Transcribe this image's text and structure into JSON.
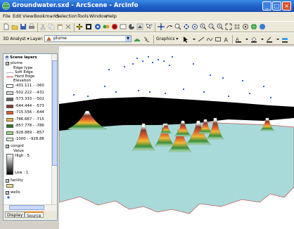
{
  "window": {
    "title": "Groundwater.sxd - ArcScene - ArcInfo",
    "buttons": {
      "minimize": "_",
      "maximize": "□",
      "close": "×"
    }
  },
  "menu": [
    "File",
    "Edit",
    "View",
    "Bookmarks",
    "Selection",
    "Tools",
    "Window",
    "Help"
  ],
  "toolbar2": {
    "analyst_label": "3D Analyst ▾",
    "layer_label": "Layer:",
    "layer_value": "plume",
    "graphics_label": "Graphics ▾"
  },
  "toc": {
    "root": "Scene layers",
    "plume": {
      "name": "plume",
      "edge_type": "Edge type",
      "soft_edge": "Soft Edge",
      "hard_edge": "Hard Edge",
      "elevation": "Elevation",
      "classes": [
        {
          "label": "-431.111 - -360",
          "color": "#ffffff"
        },
        {
          "label": "-502.222 - -431",
          "color": "#d9d9d9"
        },
        {
          "label": "-573.333 - -502",
          "color": "#6e6e6e"
        },
        {
          "label": "-644.444 - -573",
          "color": "#8c3a2e"
        },
        {
          "label": "-715.556 - -644",
          "color": "#dd5a2a"
        },
        {
          "label": "-786.667 - -715",
          "color": "#f2b733"
        },
        {
          "label": "-857.778 - -786",
          "color": "#1f7a1f"
        },
        {
          "label": "-928.889 - -857",
          "color": "#9ad98c"
        },
        {
          "label": "-1000 - -928.88",
          "color": "#e6f5e0"
        }
      ]
    },
    "congrd": {
      "name": "congrd",
      "value": "Value",
      "high": "High : 5",
      "low": "Low : 1"
    },
    "facility": {
      "name": "facility"
    },
    "wells": {
      "name": "wells"
    }
  },
  "tabs": {
    "display": "Display",
    "source": "Source"
  },
  "colors": {
    "titlebar": "#1f5fc8",
    "sky": "#ffffff",
    "water": "#a9dada",
    "plume_dark": "#000000",
    "peak_top": "#ffffff",
    "wells": "#2a63d6"
  }
}
